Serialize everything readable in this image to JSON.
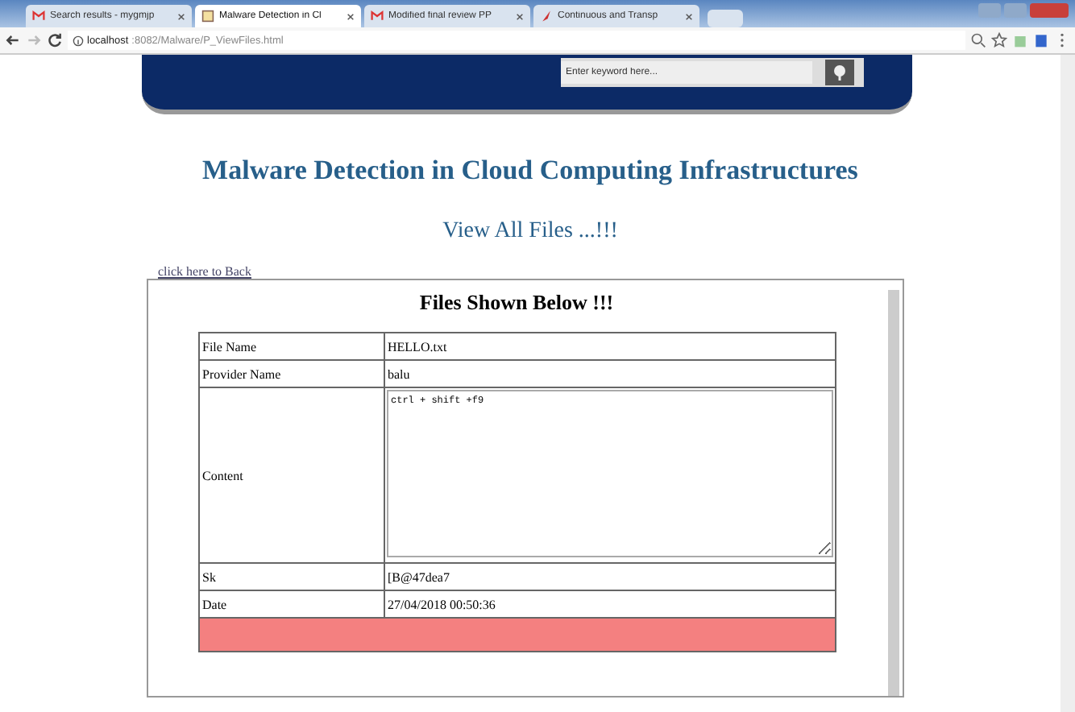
{
  "browser": {
    "tabs": [
      {
        "label": "Search results - mygmjp",
        "kind": "mail",
        "selected": false
      },
      {
        "label": "Malware Detection in Cl",
        "kind": "page",
        "selected": true
      },
      {
        "label": "Modified final review PP",
        "kind": "mail",
        "selected": false
      },
      {
        "label": "Continuous and Transp",
        "kind": "feather",
        "selected": false
      }
    ],
    "address": {
      "host": "localhost",
      "path": ":8082/Malware/P_ViewFiles.html"
    }
  },
  "header": {
    "search": {
      "placeholder": "Enter keyword here..."
    }
  },
  "title": "Malware Detection in Cloud Computing Infrastructures",
  "subtitle": "View All Files ...!!!",
  "back_link": "click here to Back",
  "panel": {
    "heading": "Files Shown Below !!!",
    "rows": [
      {
        "kind": "text",
        "label": "File Name",
        "value": "HELLO.txt"
      },
      {
        "kind": "text",
        "label": "Provider Name",
        "value": "balu"
      },
      {
        "kind": "textarea",
        "label": "Content",
        "value": "ctrl + shift +f9"
      },
      {
        "kind": "text",
        "label": "Sk",
        "value": "[B@47dea7"
      },
      {
        "kind": "text",
        "label": "Date",
        "value": "27/04/2018 00:50:36"
      }
    ]
  }
}
